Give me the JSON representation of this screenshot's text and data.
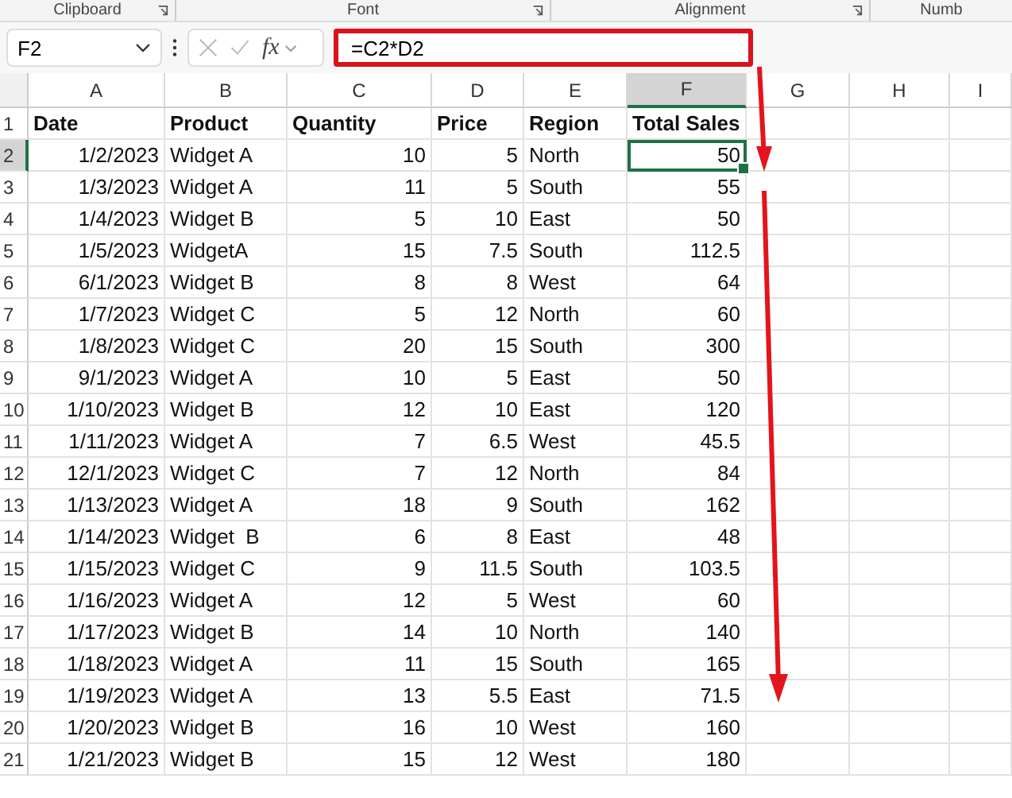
{
  "ribbon_groups": [
    "Clipboard",
    "Font",
    "Alignment",
    "Numb"
  ],
  "formula_bar": {
    "name_box": "F2",
    "fx": "fx",
    "formula": "=C2*D2",
    "highlighted": true
  },
  "columns": [
    {
      "label": "A",
      "selected": false,
      "kind": "number"
    },
    {
      "label": "B",
      "selected": false,
      "kind": "text"
    },
    {
      "label": "C",
      "selected": false,
      "kind": "number"
    },
    {
      "label": "D",
      "selected": false,
      "kind": "number"
    },
    {
      "label": "E",
      "selected": false,
      "kind": "text"
    },
    {
      "label": "F",
      "selected": true,
      "kind": "number"
    },
    {
      "label": "G",
      "selected": false
    },
    {
      "label": "H",
      "selected": false
    },
    {
      "label": "I",
      "selected": false
    }
  ],
  "rows": [
    {
      "number": "1",
      "selected": false,
      "kind": "header",
      "cells": [
        "Date",
        "Product",
        "Quantity",
        "Price",
        "Region",
        "Total Sales"
      ]
    },
    {
      "number": "2",
      "selected": true,
      "kind": "data",
      "cells": [
        "1/2/2023",
        "Widget A",
        "10",
        "5",
        "North",
        "50"
      ]
    },
    {
      "number": "3",
      "selected": false,
      "kind": "data",
      "cells": [
        "1/3/2023",
        "Widget A",
        "11",
        "5",
        "South",
        "55"
      ]
    },
    {
      "number": "4",
      "selected": false,
      "kind": "data",
      "cells": [
        "1/4/2023",
        "Widget B",
        "5",
        "10",
        "East",
        "50"
      ]
    },
    {
      "number": "5",
      "selected": false,
      "kind": "data",
      "cells": [
        "1/5/2023",
        "WidgetA",
        "15",
        "7.5",
        "South",
        "112.5"
      ]
    },
    {
      "number": "6",
      "selected": false,
      "kind": "data",
      "cells": [
        "6/1/2023",
        "Widget B",
        "8",
        "8",
        "West",
        "64"
      ]
    },
    {
      "number": "7",
      "selected": false,
      "kind": "data",
      "cells": [
        "1/7/2023",
        "Widget C",
        "5",
        "12",
        "North",
        "60"
      ]
    },
    {
      "number": "8",
      "selected": false,
      "kind": "data",
      "cells": [
        "1/8/2023",
        "Widget C",
        "20",
        "15",
        "South",
        "300"
      ]
    },
    {
      "number": "9",
      "selected": false,
      "kind": "data",
      "cells": [
        "9/1/2023",
        "Widget A",
        "10",
        "5",
        "East",
        "50"
      ]
    },
    {
      "number": "10",
      "selected": false,
      "kind": "data",
      "cells": [
        "1/10/2023",
        "Widget B",
        "12",
        "10",
        "East",
        "120"
      ]
    },
    {
      "number": "11",
      "selected": false,
      "kind": "data",
      "cells": [
        "1/11/2023",
        "Widget A",
        "7",
        "6.5",
        "West",
        "45.5"
      ]
    },
    {
      "number": "12",
      "selected": false,
      "kind": "data",
      "cells": [
        "12/1/2023",
        "Widget C",
        "7",
        "12",
        "North",
        "84"
      ]
    },
    {
      "number": "13",
      "selected": false,
      "kind": "data",
      "cells": [
        "1/13/2023",
        "Widget A",
        "18",
        "9",
        "South",
        "162"
      ]
    },
    {
      "number": "14",
      "selected": false,
      "kind": "data",
      "cells": [
        "1/14/2023",
        "Widget  B",
        "6",
        "8",
        "East",
        "48"
      ]
    },
    {
      "number": "15",
      "selected": false,
      "kind": "data",
      "cells": [
        "1/15/2023",
        "Widget C",
        "9",
        "11.5",
        "South",
        "103.5"
      ]
    },
    {
      "number": "16",
      "selected": false,
      "kind": "data",
      "cells": [
        "1/16/2023",
        "Widget A",
        "12",
        "5",
        "West",
        "60"
      ]
    },
    {
      "number": "17",
      "selected": false,
      "kind": "data",
      "cells": [
        "1/17/2023",
        "Widget B",
        "14",
        "10",
        "North",
        "140"
      ]
    },
    {
      "number": "18",
      "selected": false,
      "kind": "data",
      "cells": [
        "1/18/2023",
        "Widget A",
        "11",
        "15",
        "South",
        "165"
      ]
    },
    {
      "number": "19",
      "selected": false,
      "kind": "data",
      "cells": [
        "1/19/2023",
        "Widget A",
        "13",
        "5.5",
        "East",
        "71.5"
      ]
    },
    {
      "number": "20",
      "selected": false,
      "kind": "data",
      "cells": [
        "1/20/2023",
        "Widget B",
        "16",
        "10",
        "West",
        "160"
      ]
    },
    {
      "number": "21",
      "selected": false,
      "kind": "data",
      "cells": [
        "1/21/2023",
        "Widget B",
        "15",
        "12",
        "West",
        "180"
      ]
    }
  ]
}
